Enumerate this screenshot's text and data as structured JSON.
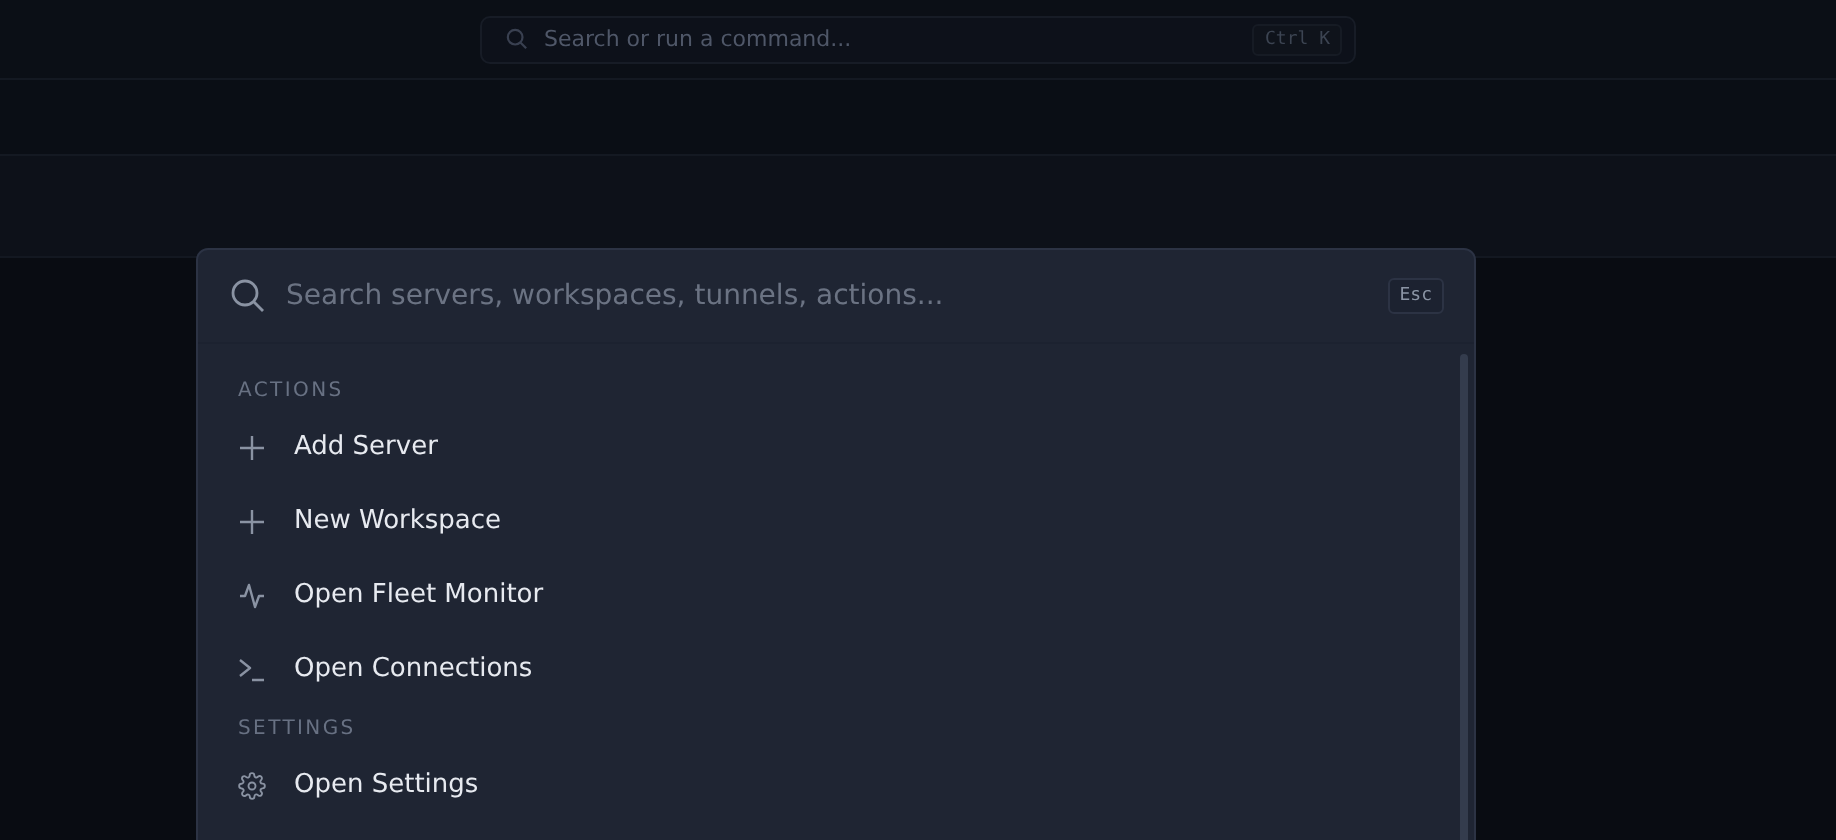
{
  "top_search": {
    "placeholder": "Search or run a command...",
    "shortcut": "Ctrl K"
  },
  "palette": {
    "placeholder": "Search servers, workspaces, tunnels, actions...",
    "shortcut": "Esc",
    "groups": [
      {
        "label": "ACTIONS",
        "items": [
          {
            "kind": "add",
            "label": "Add Server"
          },
          {
            "kind": "add",
            "label": "New Workspace"
          },
          {
            "kind": "monitor",
            "label": "Open Fleet Monitor"
          },
          {
            "kind": "terminal",
            "label": "Open Connections"
          }
        ]
      },
      {
        "label": "SETTINGS",
        "items": [
          {
            "kind": "settings",
            "label": "Open Settings"
          }
        ]
      }
    ]
  }
}
